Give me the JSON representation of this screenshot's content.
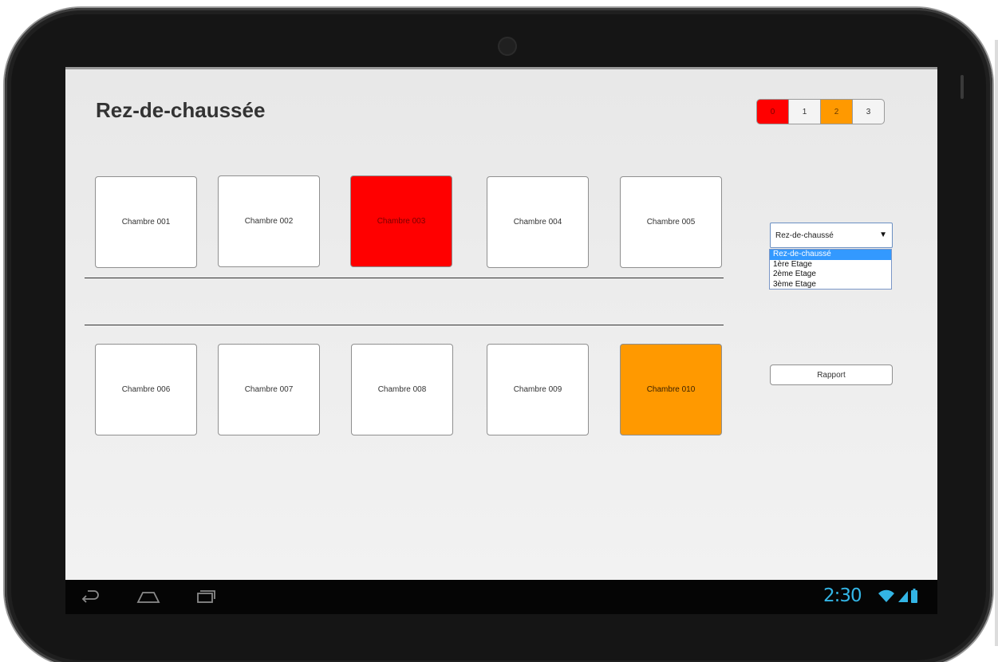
{
  "page": {
    "title": "Rez-de-chaussée"
  },
  "floor_buttons": [
    {
      "label": "0",
      "status": "red"
    },
    {
      "label": "1",
      "status": "normal"
    },
    {
      "label": "2",
      "status": "orange"
    },
    {
      "label": "3",
      "status": "normal"
    }
  ],
  "rooms_row1": [
    {
      "label": "Chambre 001",
      "status": "normal"
    },
    {
      "label": "Chambre 002",
      "status": "normal"
    },
    {
      "label": "Chambre 003",
      "status": "red"
    },
    {
      "label": "Chambre 004",
      "status": "normal"
    },
    {
      "label": "Chambre 005",
      "status": "normal"
    }
  ],
  "rooms_row2": [
    {
      "label": "Chambre 006",
      "status": "normal"
    },
    {
      "label": "Chambre 007",
      "status": "normal"
    },
    {
      "label": "Chambre 008",
      "status": "normal"
    },
    {
      "label": "Chambre 009",
      "status": "normal"
    },
    {
      "label": "Chambre 010",
      "status": "orange"
    }
  ],
  "floor_select": {
    "value": "Rez-de-chaussé",
    "options": [
      "Rez-de-chaussé",
      "1ère Etage",
      "2ème Etage",
      "3ème Etage"
    ],
    "selected_index": 0
  },
  "report_button": {
    "label": "Rapport"
  },
  "status_bar": {
    "time": "2:30"
  },
  "colors": {
    "red": "#ff0000",
    "orange": "#ff9900",
    "clock": "#33b5e5",
    "selection": "#3399ff"
  },
  "icons": [
    "back-icon",
    "home-icon",
    "recent-apps-icon",
    "wifi-icon",
    "signal-icon",
    "battery-icon"
  ]
}
